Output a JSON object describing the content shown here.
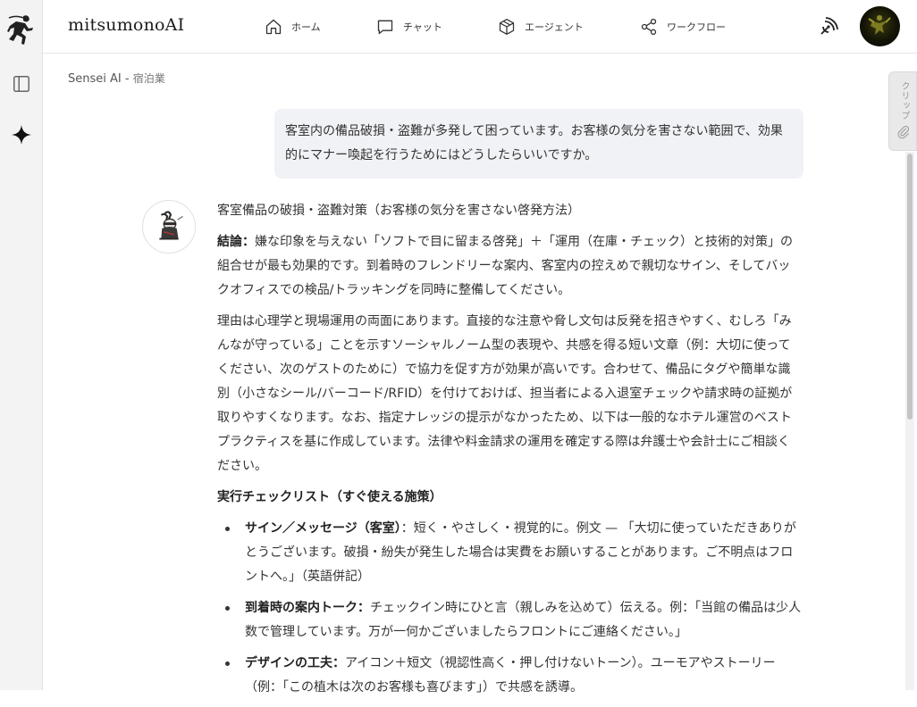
{
  "app": {
    "brand": "mitsumonoAI"
  },
  "nav": [
    {
      "label": "ホーム",
      "icon": "home-icon"
    },
    {
      "label": "チャット",
      "icon": "chat-icon"
    },
    {
      "label": "エージェント",
      "icon": "cube-icon"
    },
    {
      "label": "ワークフロー",
      "icon": "share-nodes-icon"
    }
  ],
  "breadcrumb": {
    "main": "Sensei AI - ",
    "sub": "宿泊業"
  },
  "clip_tab": {
    "label": "クリップ"
  },
  "user_message": "客室内の備品破損・盗難が多発して困っています。お客様の気分を害さない範囲で、効果的にマナー喚起を行うためにはどうしたらいいですか。",
  "answer": {
    "title": "客室備品の破損・盗難対策（お客様の気分を害さない啓発方法）",
    "conclusion_label": "結論：",
    "conclusion_text": "嫌な印象を与えない「ソフトで目に留まる啓発」＋「運用（在庫・チェック）と技術的対策」の組合せが最も効果的です。到着時のフレンドリーな案内、客室内の控えめで親切なサイン、そしてバックオフィスでの検品/トラッキングを同時に整備してください。",
    "reason": "理由は心理学と現場運用の両面にあります。直接的な注意や脅し文句は反発を招きやすく、むしろ「みんなが守っている」ことを示すソーシャルノーム型の表現や、共感を得る短い文章（例：大切に使ってください、次のゲストのために）で協力を促す方が効果が高いです。合わせて、備品にタグや簡単な識別（小さなシール/バーコード/RFID）を付けておけば、担当者による入退室チェックや請求時の証拠が取りやすくなります。なお、指定ナレッジの提示がなかったため、以下は一般的なホテル運営のベストプラクティスを基に作成しています。法律や料金請求の運用を確定する際は弁護士や会計士にご相談ください。",
    "checklist_heading": "実行チェックリスト（すぐ使える施策）",
    "items": [
      {
        "label": "サイン／メッセージ（客室）",
        "text": "：短く・やさしく・視覚的に。例文 — 「大切に使っていただきありがとうございます。破損・紛失が発生した場合は実費をお願いすることがあります。ご不明点はフロントへ。」（英語併記）"
      },
      {
        "label": "到着時の案内トーク：",
        "text": "チェックイン時にひと言（親しみを込めて）伝える。例：「当館の備品は少人数で管理しています。万が一何かございましたらフロントにご連絡ください。」"
      },
      {
        "label": "デザインの工夫：",
        "text": "アイコン＋短文（視認性高く・押し付けないトーン）。ユーモアやストーリー（例：「この植木は次のお客様も喜びます」）で共感を誘導。"
      }
    ]
  },
  "colors": {
    "rail_bg": "#f3f3f3",
    "user_bubble": "#f1f2f6",
    "accent": "#222222"
  }
}
